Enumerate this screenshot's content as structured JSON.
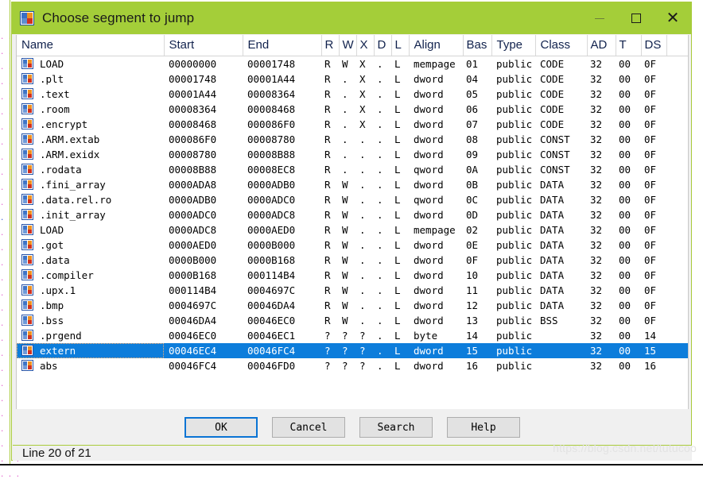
{
  "window": {
    "title": "Choose segment to jump",
    "icon": "ida-segments-icon",
    "minimize_label": "",
    "maximize_label": "",
    "close_label": "✕"
  },
  "table": {
    "columns": [
      {
        "key": "name",
        "label": "Name"
      },
      {
        "key": "start",
        "label": "Start"
      },
      {
        "key": "end",
        "label": "End"
      },
      {
        "key": "r",
        "label": "R"
      },
      {
        "key": "w",
        "label": "W"
      },
      {
        "key": "x",
        "label": "X"
      },
      {
        "key": "d",
        "label": "D"
      },
      {
        "key": "l",
        "label": "L"
      },
      {
        "key": "align",
        "label": "Align"
      },
      {
        "key": "bas",
        "label": "Bas"
      },
      {
        "key": "type",
        "label": "Type"
      },
      {
        "key": "class",
        "label": "Class"
      },
      {
        "key": "ad",
        "label": "AD"
      },
      {
        "key": "t",
        "label": "T"
      },
      {
        "key": "ds",
        "label": "DS"
      },
      {
        "key": "pad",
        "label": ""
      }
    ],
    "rows": [
      {
        "name": "LOAD",
        "start": "00000000",
        "end": "00001748",
        "r": "R",
        "w": "W",
        "x": "X",
        "d": ".",
        "l": "L",
        "align": "mempage",
        "bas": "01",
        "type": "public",
        "class": "CODE",
        "ad": "32",
        "t": "00",
        "ds": "0F",
        "selected": false
      },
      {
        "name": ".plt",
        "start": "00001748",
        "end": "00001A44",
        "r": "R",
        "w": ".",
        "x": "X",
        "d": ".",
        "l": "L",
        "align": "dword",
        "bas": "04",
        "type": "public",
        "class": "CODE",
        "ad": "32",
        "t": "00",
        "ds": "0F",
        "selected": false
      },
      {
        "name": ".text",
        "start": "00001A44",
        "end": "00008364",
        "r": "R",
        "w": ".",
        "x": "X",
        "d": ".",
        "l": "L",
        "align": "dword",
        "bas": "05",
        "type": "public",
        "class": "CODE",
        "ad": "32",
        "t": "00",
        "ds": "0F",
        "selected": false
      },
      {
        "name": ".room",
        "start": "00008364",
        "end": "00008468",
        "r": "R",
        "w": ".",
        "x": "X",
        "d": ".",
        "l": "L",
        "align": "dword",
        "bas": "06",
        "type": "public",
        "class": "CODE",
        "ad": "32",
        "t": "00",
        "ds": "0F",
        "selected": false
      },
      {
        "name": ".encrypt",
        "start": "00008468",
        "end": "000086F0",
        "r": "R",
        "w": ".",
        "x": "X",
        "d": ".",
        "l": "L",
        "align": "dword",
        "bas": "07",
        "type": "public",
        "class": "CODE",
        "ad": "32",
        "t": "00",
        "ds": "0F",
        "selected": false
      },
      {
        "name": ".ARM.extab",
        "start": "000086F0",
        "end": "00008780",
        "r": "R",
        "w": ".",
        "x": ".",
        "d": ".",
        "l": "L",
        "align": "dword",
        "bas": "08",
        "type": "public",
        "class": "CONST",
        "ad": "32",
        "t": "00",
        "ds": "0F",
        "selected": false
      },
      {
        "name": ".ARM.exidx",
        "start": "00008780",
        "end": "00008B88",
        "r": "R",
        "w": ".",
        "x": ".",
        "d": ".",
        "l": "L",
        "align": "dword",
        "bas": "09",
        "type": "public",
        "class": "CONST",
        "ad": "32",
        "t": "00",
        "ds": "0F",
        "selected": false
      },
      {
        "name": ".rodata",
        "start": "00008B88",
        "end": "00008EC8",
        "r": "R",
        "w": ".",
        "x": ".",
        "d": ".",
        "l": "L",
        "align": "qword",
        "bas": "0A",
        "type": "public",
        "class": "CONST",
        "ad": "32",
        "t": "00",
        "ds": "0F",
        "selected": false
      },
      {
        "name": ".fini_array",
        "start": "0000ADA8",
        "end": "0000ADB0",
        "r": "R",
        "w": "W",
        "x": ".",
        "d": ".",
        "l": "L",
        "align": "dword",
        "bas": "0B",
        "type": "public",
        "class": "DATA",
        "ad": "32",
        "t": "00",
        "ds": "0F",
        "selected": false
      },
      {
        "name": ".data.rel.ro",
        "start": "0000ADB0",
        "end": "0000ADC0",
        "r": "R",
        "w": "W",
        "x": ".",
        "d": ".",
        "l": "L",
        "align": "qword",
        "bas": "0C",
        "type": "public",
        "class": "DATA",
        "ad": "32",
        "t": "00",
        "ds": "0F",
        "selected": false
      },
      {
        "name": ".init_array",
        "start": "0000ADC0",
        "end": "0000ADC8",
        "r": "R",
        "w": "W",
        "x": ".",
        "d": ".",
        "l": "L",
        "align": "dword",
        "bas": "0D",
        "type": "public",
        "class": "DATA",
        "ad": "32",
        "t": "00",
        "ds": "0F",
        "selected": false
      },
      {
        "name": "LOAD",
        "start": "0000ADC8",
        "end": "0000AED0",
        "r": "R",
        "w": "W",
        "x": ".",
        "d": ".",
        "l": "L",
        "align": "mempage",
        "bas": "02",
        "type": "public",
        "class": "DATA",
        "ad": "32",
        "t": "00",
        "ds": "0F",
        "selected": false
      },
      {
        "name": ".got",
        "start": "0000AED0",
        "end": "0000B000",
        "r": "R",
        "w": "W",
        "x": ".",
        "d": ".",
        "l": "L",
        "align": "dword",
        "bas": "0E",
        "type": "public",
        "class": "DATA",
        "ad": "32",
        "t": "00",
        "ds": "0F",
        "selected": false
      },
      {
        "name": ".data",
        "start": "0000B000",
        "end": "0000B168",
        "r": "R",
        "w": "W",
        "x": ".",
        "d": ".",
        "l": "L",
        "align": "dword",
        "bas": "0F",
        "type": "public",
        "class": "DATA",
        "ad": "32",
        "t": "00",
        "ds": "0F",
        "selected": false
      },
      {
        "name": ".compiler",
        "start": "0000B168",
        "end": "000114B4",
        "r": "R",
        "w": "W",
        "x": ".",
        "d": ".",
        "l": "L",
        "align": "dword",
        "bas": "10",
        "type": "public",
        "class": "DATA",
        "ad": "32",
        "t": "00",
        "ds": "0F",
        "selected": false
      },
      {
        "name": ".upx.1",
        "start": "000114B4",
        "end": "0004697C",
        "r": "R",
        "w": "W",
        "x": ".",
        "d": ".",
        "l": "L",
        "align": "dword",
        "bas": "11",
        "type": "public",
        "class": "DATA",
        "ad": "32",
        "t": "00",
        "ds": "0F",
        "selected": false
      },
      {
        "name": ".bmp",
        "start": "0004697C",
        "end": "00046DA4",
        "r": "R",
        "w": "W",
        "x": ".",
        "d": ".",
        "l": "L",
        "align": "dword",
        "bas": "12",
        "type": "public",
        "class": "DATA",
        "ad": "32",
        "t": "00",
        "ds": "0F",
        "selected": false
      },
      {
        "name": ".bss",
        "start": "00046DA4",
        "end": "00046EC0",
        "r": "R",
        "w": "W",
        "x": ".",
        "d": ".",
        "l": "L",
        "align": "dword",
        "bas": "13",
        "type": "public",
        "class": "BSS",
        "ad": "32",
        "t": "00",
        "ds": "0F",
        "selected": false
      },
      {
        "name": ".prgend",
        "start": "00046EC0",
        "end": "00046EC1",
        "r": "?",
        "w": "?",
        "x": "?",
        "d": ".",
        "l": "L",
        "align": "byte",
        "bas": "14",
        "type": "public",
        "class": "",
        "ad": "32",
        "t": "00",
        "ds": "14",
        "selected": false
      },
      {
        "name": "extern",
        "start": "00046EC4",
        "end": "00046FC4",
        "r": "?",
        "w": "?",
        "x": "?",
        "d": ".",
        "l": "L",
        "align": "dword",
        "bas": "15",
        "type": "public",
        "class": "",
        "ad": "32",
        "t": "00",
        "ds": "15",
        "selected": true
      },
      {
        "name": "abs",
        "start": "00046FC4",
        "end": "00046FD0",
        "r": "?",
        "w": "?",
        "x": "?",
        "d": ".",
        "l": "L",
        "align": "dword",
        "bas": "16",
        "type": "public",
        "class": "",
        "ad": "32",
        "t": "00",
        "ds": "16",
        "selected": false
      }
    ]
  },
  "buttons": [
    {
      "label": "OK",
      "name": "ok-button",
      "default": true
    },
    {
      "label": "Cancel",
      "name": "cancel-button",
      "default": false
    },
    {
      "label": "Search",
      "name": "search-button",
      "default": false
    },
    {
      "label": "Help",
      "name": "help-button",
      "default": false
    }
  ],
  "status": {
    "line_text": "Line 20 of 21"
  },
  "watermark": {
    "text": "https://blog.csdn.net/tutucoo"
  },
  "colors": {
    "titlebar": "#a4ce39",
    "selection": "#0d7ddb",
    "dialog_bg": "#f0f0f0",
    "default_button_border": "#0a74d4",
    "header_text": "#11224d"
  },
  "backdrop": {
    "lines": [
      ". . .",
      ". . .",
      ". . .",
      ". . .",
      ". . .",
      ". . .",
      ". . .",
      ". . .",
      ". . .",
      ". . .",
      ". . .",
      ". . .",
      ". . .",
      ". . .",
      ". . .",
      ". . .",
      ". . .",
      ". . .",
      ". . .",
      ". . .",
      ". . .",
      ". . .",
      ". . .",
      ". . .",
      ". . .",
      ". . .",
      ". . .",
      ". . .",
      ". . .",
      ". . ."
    ]
  }
}
